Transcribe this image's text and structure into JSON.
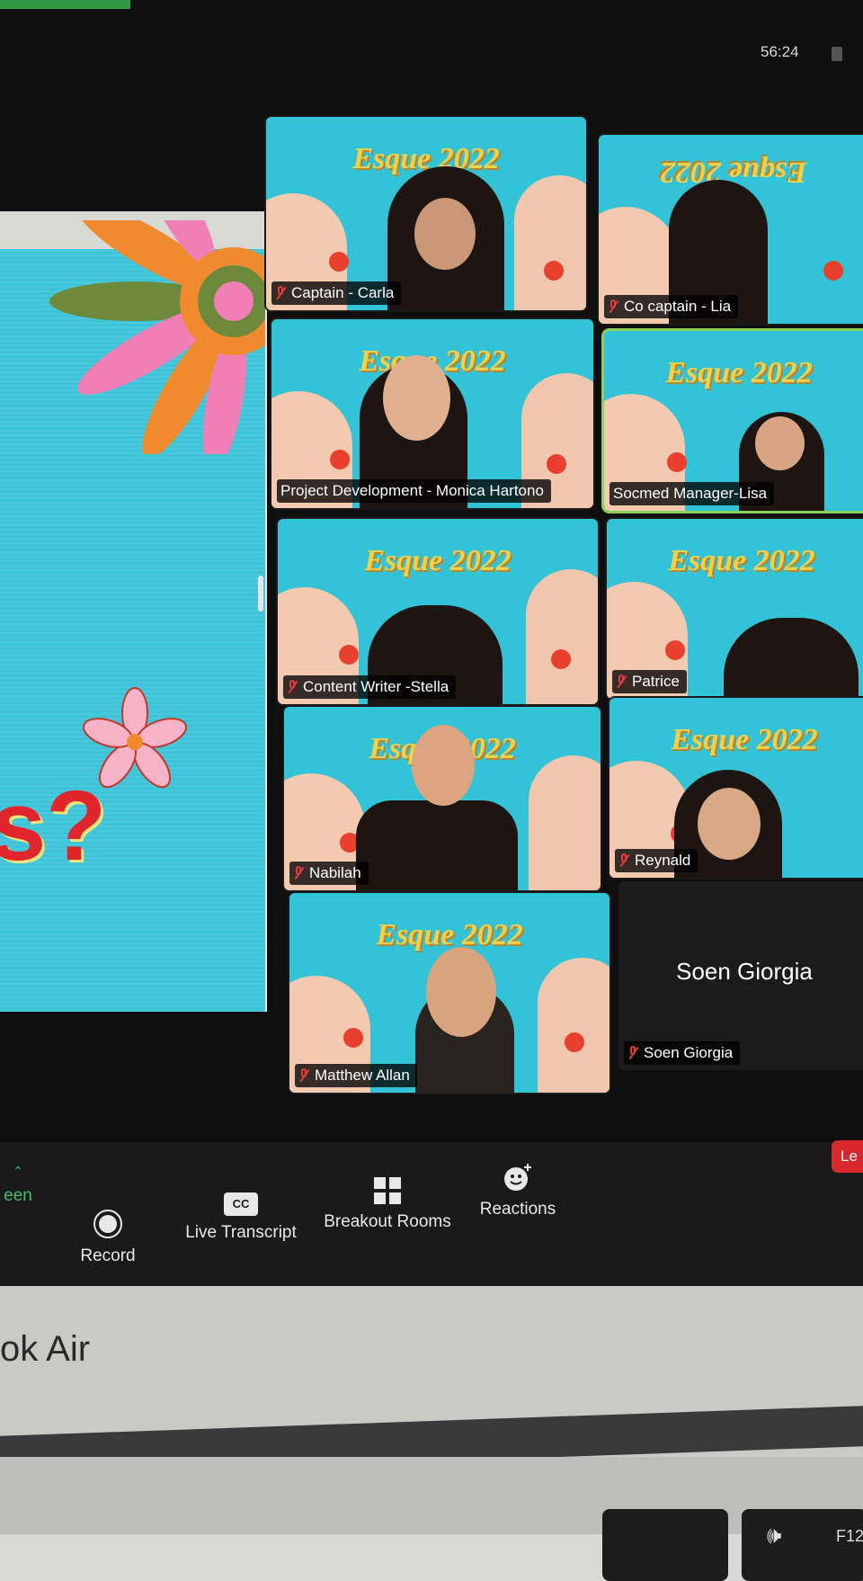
{
  "meeting": {
    "timer": "56:24"
  },
  "shared_screen": {
    "visible_text": "s?"
  },
  "participants": [
    {
      "name": "Captain - Carla",
      "muted": true,
      "background_text": "Esque 2022"
    },
    {
      "name": "Co captain - Lia",
      "muted": true,
      "background_text": "Esque 2022"
    },
    {
      "name": "Project Development - Monica Hartono",
      "muted": false,
      "background_text": "Esque 2022"
    },
    {
      "name": "Socmed Manager-Lisa",
      "muted": false,
      "background_text": "Esque 2022"
    },
    {
      "name": "Content Writer -Stella",
      "muted": true,
      "background_text": "Esque 2022"
    },
    {
      "name": "Patrice",
      "muted": true,
      "background_text": "Esque 2022"
    },
    {
      "name": "Nabilah",
      "muted": true,
      "background_text": "Esque 2022"
    },
    {
      "name": "Reynald",
      "muted": true,
      "background_text": "Esque 2022"
    },
    {
      "name": "Matthew Allan",
      "muted": true,
      "background_text": "Esque 2022"
    },
    {
      "name": "Soen Giorgia",
      "muted": true,
      "camera_off": true,
      "display_name": "Soen Giorgia"
    }
  ],
  "toolbar": {
    "share_partial": "een",
    "record": "Record",
    "cc_badge": "CC",
    "live_transcript": "Live Transcript",
    "breakout_rooms": "Breakout Rooms",
    "reactions": "Reactions",
    "leave_partial": "Le"
  },
  "device": {
    "brand_partial": "ok Air",
    "key_label": "F12"
  }
}
